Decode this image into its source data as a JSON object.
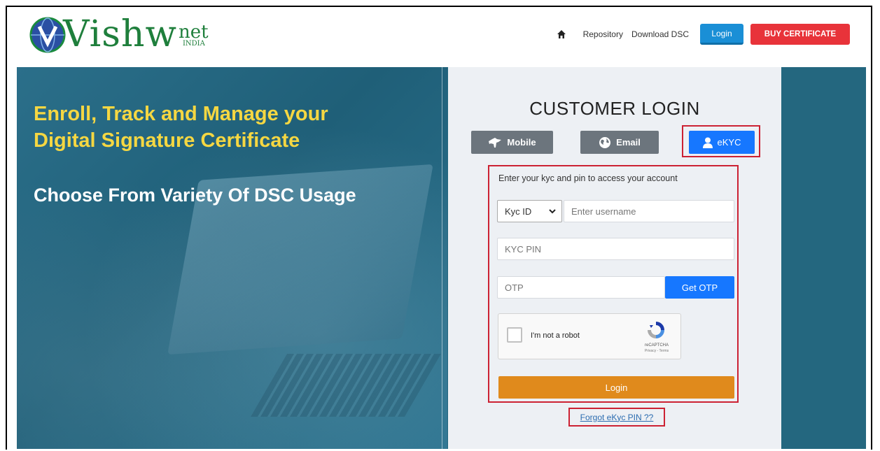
{
  "header": {
    "logo": {
      "brand": "Vishw",
      "suffix": "net",
      "region": "INDIA"
    },
    "nav": {
      "home_icon": "home-icon",
      "repository": "Repository",
      "download_dsc": "Download DSC",
      "login": "Login",
      "buy_certificate": "BUY CERTIFICATE"
    }
  },
  "hero": {
    "title_line1": "Enroll, Track and Manage your",
    "title_line2": "Digital Signature Certificate",
    "subtitle": "Choose From Variety Of DSC Usage"
  },
  "login": {
    "heading": "CUSTOMER LOGIN",
    "tabs": [
      {
        "label": "Mobile",
        "icon": "india-map-icon"
      },
      {
        "label": "Email",
        "icon": "globe-icon"
      },
      {
        "label": "eKYC",
        "icon": "user-icon",
        "active": true
      }
    ],
    "instruction": "Enter your kyc and pin to access your account",
    "id_select": {
      "selected": "Kyc ID"
    },
    "username": {
      "placeholder": "Enter username"
    },
    "pin": {
      "placeholder": "KYC PIN"
    },
    "otp": {
      "placeholder": "OTP",
      "button": "Get OTP"
    },
    "captcha": {
      "label": "I'm not a robot",
      "brand": "reCAPTCHA",
      "terms": "Privacy - Terms"
    },
    "submit": "Login",
    "forgot": "Forgot eKyc PIN ??"
  },
  "colors": {
    "hero_bg": "#24677f",
    "title_yellow": "#f5d742",
    "primary_blue": "#1677ff",
    "buy_red": "#e8333a",
    "login_orange": "#e08a1c",
    "highlight_red": "#cc2233"
  }
}
